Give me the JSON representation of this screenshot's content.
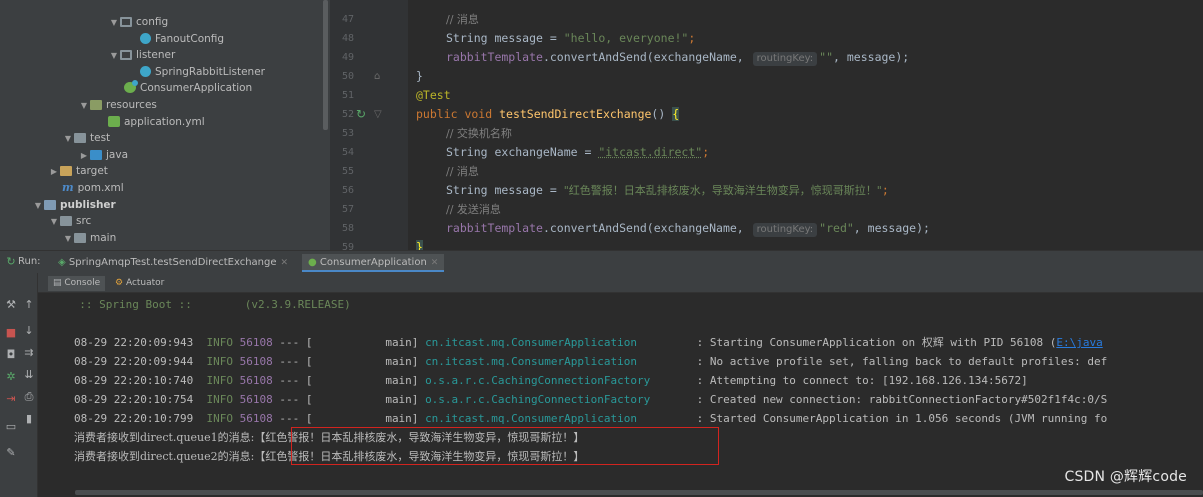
{
  "project_tree": {
    "items": [
      {
        "label": "config",
        "kind": "package",
        "expanded": true
      },
      {
        "label": "FanoutConfig",
        "kind": "class"
      },
      {
        "label": "listener",
        "kind": "package",
        "expanded": true
      },
      {
        "label": "SpringRabbitListener",
        "kind": "class"
      },
      {
        "label": "ConsumerApplication",
        "kind": "spring-class"
      },
      {
        "label": "resources",
        "kind": "resources",
        "expanded": true
      },
      {
        "label": "application.yml",
        "kind": "yml"
      },
      {
        "label": "test",
        "kind": "folder",
        "expanded": true
      },
      {
        "label": "java",
        "kind": "java",
        "expanded": false
      },
      {
        "label": "target",
        "kind": "target",
        "expanded": false
      },
      {
        "label": "pom.xml",
        "kind": "maven"
      },
      {
        "label": "publisher",
        "kind": "module",
        "expanded": true
      },
      {
        "label": "src",
        "kind": "folder",
        "expanded": true
      },
      {
        "label": "main",
        "kind": "folder",
        "expanded": true
      }
    ]
  },
  "editor": {
    "line_numbers": [
      "47",
      "48",
      "49",
      "50",
      "51",
      "52",
      "53",
      "54",
      "55",
      "56",
      "57",
      "58",
      "59"
    ],
    "lines": {
      "l47_comment": "// 消息",
      "l48_type": "String",
      "l48_var": " message = ",
      "l48_str": "\"hello, everyone!\"",
      "l48_end": ";",
      "l49_field": "rabbitTemplate",
      "l49_call": ".convertAndSend(exchangeName, ",
      "l49_hint": "routingKey:",
      "l49_str": "\"\"",
      "l49_end": ", message);",
      "l50_brace": "}",
      "l51_ann": "@Test",
      "l52_kw": "public void ",
      "l52_fn": "testSendDirectExchange",
      "l52_paren": "() ",
      "l52_brace": "{",
      "l53_comment": "// 交换机名称",
      "l54_type": "String",
      "l54_var": " exchangeName = ",
      "l54_str": "\"itcast.direct\"",
      "l54_end": ";",
      "l55_comment": "// 消息",
      "l56_type": "String",
      "l56_var": " message = ",
      "l56_str": "\"红色警报！日本乱排核废水，导致海洋生物变异，惊现哥斯拉！\"",
      "l56_end": ";",
      "l57_comment": "// 发送消息",
      "l58_field": "rabbitTemplate",
      "l58_call": ".convertAndSend(exchangeName, ",
      "l58_hint": "routingKey:",
      "l58_str": "\"red\"",
      "l58_end": ", message);",
      "l59_brace": "}"
    }
  },
  "run_window": {
    "label": "Run:",
    "tabs": [
      {
        "label": "SpringAmqpTest.testSendDirectExchange",
        "active": false
      },
      {
        "label": "ConsumerApplication",
        "active": true
      }
    ],
    "sub_tabs": [
      {
        "label": "Console",
        "active": true
      },
      {
        "label": "Actuator",
        "active": false
      }
    ]
  },
  "console": {
    "banner": "  :: Spring Boot ::        (v2.3.9.RELEASE)",
    "logs": [
      {
        "time": "08-29 22:20:09:943",
        "level": "INFO",
        "pid": "56108",
        "sep": " --- [",
        "thread": "           main] ",
        "logger": "cn.itcast.mq.ConsumerApplication        ",
        "msg": " : Starting ConsumerApplication on 权辉 with PID 56108 (",
        "link": "E:\\java"
      },
      {
        "time": "08-29 22:20:09:944",
        "level": "INFO",
        "pid": "56108",
        "sep": " --- [",
        "thread": "           main] ",
        "logger": "cn.itcast.mq.ConsumerApplication        ",
        "msg": " : No active profile set, falling back to default profiles: def",
        "link": ""
      },
      {
        "time": "08-29 22:20:10:740",
        "level": "INFO",
        "pid": "56108",
        "sep": " --- [",
        "thread": "           main] ",
        "logger": "o.s.a.r.c.CachingConnectionFactory      ",
        "msg": " : Attempting to connect to: [192.168.126.134:5672]",
        "link": ""
      },
      {
        "time": "08-29 22:20:10:754",
        "level": "INFO",
        "pid": "56108",
        "sep": " --- [",
        "thread": "           main] ",
        "logger": "o.s.a.r.c.CachingConnectionFactory      ",
        "msg": " : Created new connection: rabbitConnectionFactory#502f1f4c:0/S",
        "link": ""
      },
      {
        "time": "08-29 22:20:10:799",
        "level": "INFO",
        "pid": "56108",
        "sep": " --- [",
        "thread": "           main] ",
        "logger": "cn.itcast.mq.ConsumerApplication        ",
        "msg": " : Started ConsumerApplication in 1.056 seconds (JVM running fo",
        "link": ""
      }
    ],
    "messages": [
      {
        "prefix": "消费者接收到direct.queue1的消息:",
        "text": "【红色警报！日本乱排核废水，导致海洋生物变异，惊现哥斯拉！】"
      },
      {
        "prefix": "消费者接收到direct.queue2的消息:",
        "text": "【红色警报！日本乱排核废水，导致海洋生物变异，惊现哥斯拉！】"
      }
    ]
  },
  "watermark": "CSDN @辉辉code",
  "colors": {
    "editor_bg": "#2b2b2b",
    "panel_bg": "#3c3f41",
    "keyword": "#cc7832",
    "string": "#6a8759",
    "logger": "#299999",
    "highlight_box": "#d2241f"
  }
}
